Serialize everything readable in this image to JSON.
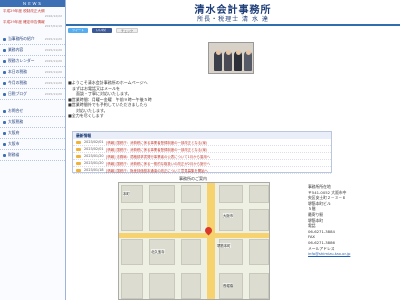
{
  "header": {
    "title": "清水会計事務所",
    "subtitle": "所長・税理士 清 水 達"
  },
  "sidebar": {
    "news_heading": "ＮＥＷＳ",
    "news": [
      {
        "text": "平成29年度 税制改正大綱",
        "date": "2016/12/22"
      },
      {
        "text": "平成29年度 確定申告情報",
        "date": "2017/01/10"
      }
    ],
    "links": [
      {
        "label": "当事務所の紹介",
        "date": "2015/11/20"
      },
      {
        "label": "業務内容",
        "date": "2015/11/20"
      },
      {
        "label": "税務カレンダー",
        "date": "2015/11/20"
      },
      {
        "label": "本日の税務",
        "date": "2015/11/20"
      },
      {
        "label": "今月の税務",
        "date": "2015/11/20"
      },
      {
        "label": "日税ブログ",
        "date": "2015/11/20"
      }
    ],
    "links2": [
      {
        "label": "お問合せ"
      },
      {
        "label": "大阪税務"
      },
      {
        "label": "大阪府"
      },
      {
        "label": "大阪市"
      },
      {
        "label": "財務省"
      }
    ]
  },
  "social": {
    "tweet": "ツイート",
    "like": "いいね！",
    "check": "チェック"
  },
  "intro": {
    "lines": [
      "■ようこそ清水会計事務所のホームページへ",
      "　まずはお電話又はメールを",
      "　　面談・丁寧に対応いたします。",
      "■営業時間：月曜～金曜　午前９時～午後５時",
      "■営業時間外でも予約していただきましたら",
      "　　対応いたします。",
      "■全力を尽くします"
    ]
  },
  "news_box": {
    "heading": "最新情報",
    "items": [
      {
        "date": "2023/02/01",
        "text": "[情報] 国税庁：消費税に係る事業者登録制度の一部改正となる(案)"
      },
      {
        "date": "2023/02/01",
        "text": "[情報] 国税庁：消費税に係る事業者登録制度の一部改正となる(案)"
      },
      {
        "date": "2023/01/20",
        "text": "[情報] 法務局：適格請求書発行事業者の公表について1月から運用へ"
      },
      {
        "date": "2023/01/20",
        "text": "[情報] 国税庁：消費税に係る一般的な取扱いの改正が2月から施行へ"
      },
      {
        "date": "2023/01/18",
        "text": "[情報] 国税庁：財産評価基本通達の改正について意見募集を開始へ"
      }
    ]
  },
  "map": {
    "title": "事務所のご案内",
    "labels": [
      "本町",
      "大阪市",
      "北久宝寺",
      "堺筋本町",
      "長堀橋"
    ]
  },
  "office_info": {
    "heading": "事務所所在地",
    "lines": [
      "〒541-0052 大阪市中",
      "央区安土町２－３－６",
      "堺筋本町ビル",
      "５階"
    ],
    "access_heading": "最寄り駅",
    "access": "堺筋本町",
    "tel_label": "電話",
    "tel": "06-6271-3884",
    "fax_label": "FAX",
    "fax": "06-6271-3886",
    "mail_label": "メールアドレス",
    "mail": "info@shimizu-tax.or.jp"
  }
}
